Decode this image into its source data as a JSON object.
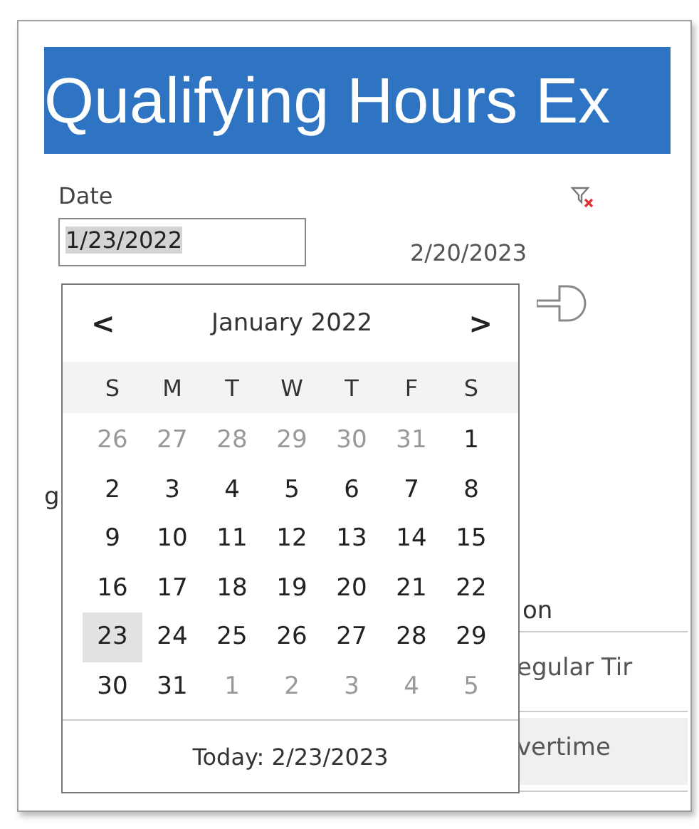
{
  "title": "Qualifying Hours Ex",
  "filter": {
    "label": "Date",
    "value": "1/23/2022",
    "end_value": "2/20/2023"
  },
  "side_text": "g",
  "table": {
    "header": "on",
    "rows": [
      {
        "text": "egular Tir",
        "selected": false
      },
      {
        "text": "vertime",
        "selected": true
      }
    ]
  },
  "calendar": {
    "prev": "<",
    "month": "January 2022",
    "next": ">",
    "weekdays": [
      "S",
      "M",
      "T",
      "W",
      "T",
      "F",
      "S"
    ],
    "days": [
      {
        "day": "26",
        "muted": true,
        "selected": false
      },
      {
        "day": "27",
        "muted": true,
        "selected": false
      },
      {
        "day": "28",
        "muted": true,
        "selected": false
      },
      {
        "day": "29",
        "muted": true,
        "selected": false
      },
      {
        "day": "30",
        "muted": true,
        "selected": false
      },
      {
        "day": "31",
        "muted": true,
        "selected": false
      },
      {
        "day": "1",
        "muted": false,
        "selected": false
      },
      {
        "day": "2",
        "muted": false,
        "selected": false
      },
      {
        "day": "3",
        "muted": false,
        "selected": false
      },
      {
        "day": "4",
        "muted": false,
        "selected": false
      },
      {
        "day": "5",
        "muted": false,
        "selected": false
      },
      {
        "day": "6",
        "muted": false,
        "selected": false
      },
      {
        "day": "7",
        "muted": false,
        "selected": false
      },
      {
        "day": "8",
        "muted": false,
        "selected": false
      },
      {
        "day": "9",
        "muted": false,
        "selected": false
      },
      {
        "day": "10",
        "muted": false,
        "selected": false
      },
      {
        "day": "11",
        "muted": false,
        "selected": false
      },
      {
        "day": "12",
        "muted": false,
        "selected": false
      },
      {
        "day": "13",
        "muted": false,
        "selected": false
      },
      {
        "day": "14",
        "muted": false,
        "selected": false
      },
      {
        "day": "15",
        "muted": false,
        "selected": false
      },
      {
        "day": "16",
        "muted": false,
        "selected": false
      },
      {
        "day": "17",
        "muted": false,
        "selected": false
      },
      {
        "day": "18",
        "muted": false,
        "selected": false
      },
      {
        "day": "19",
        "muted": false,
        "selected": false
      },
      {
        "day": "20",
        "muted": false,
        "selected": false
      },
      {
        "day": "21",
        "muted": false,
        "selected": false
      },
      {
        "day": "22",
        "muted": false,
        "selected": false
      },
      {
        "day": "23",
        "muted": false,
        "selected": true
      },
      {
        "day": "24",
        "muted": false,
        "selected": false
      },
      {
        "day": "25",
        "muted": false,
        "selected": false
      },
      {
        "day": "26",
        "muted": false,
        "selected": false
      },
      {
        "day": "27",
        "muted": false,
        "selected": false
      },
      {
        "day": "28",
        "muted": false,
        "selected": false
      },
      {
        "day": "29",
        "muted": false,
        "selected": false
      },
      {
        "day": "30",
        "muted": false,
        "selected": false
      },
      {
        "day": "31",
        "muted": false,
        "selected": false
      },
      {
        "day": "1",
        "muted": true,
        "selected": false
      },
      {
        "day": "2",
        "muted": true,
        "selected": false
      },
      {
        "day": "3",
        "muted": true,
        "selected": false
      },
      {
        "day": "4",
        "muted": true,
        "selected": false
      },
      {
        "day": "5",
        "muted": true,
        "selected": false
      }
    ],
    "today": "Today: 2/23/2023"
  }
}
